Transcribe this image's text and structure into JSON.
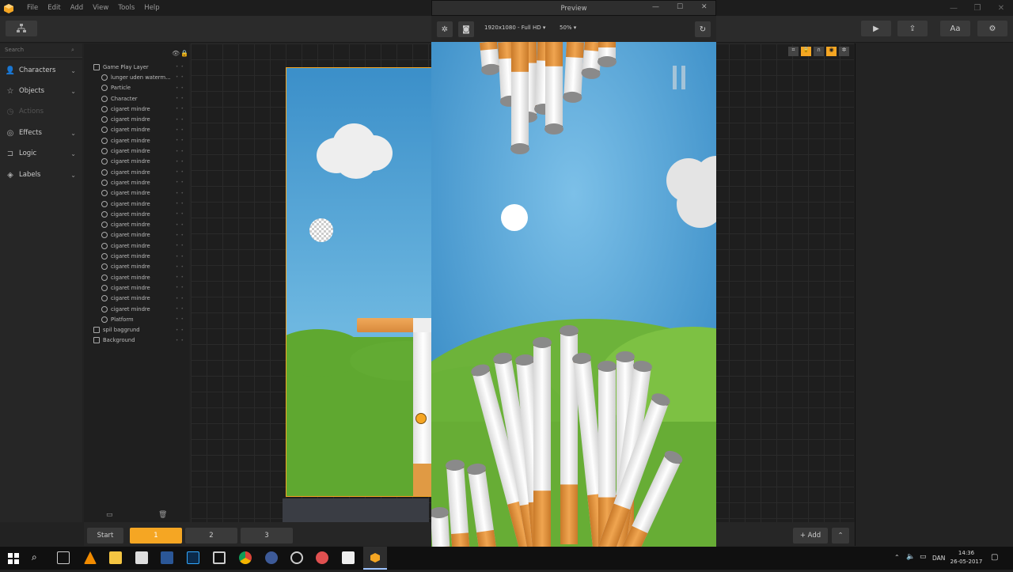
{
  "menu": [
    "File",
    "Edit",
    "Add",
    "View",
    "Tools",
    "Help"
  ],
  "search": {
    "placeholder": "Search"
  },
  "categories": [
    {
      "label": "Characters",
      "icon": "person-icon"
    },
    {
      "label": "Objects",
      "icon": "star-icon"
    },
    {
      "label": "Actions",
      "icon": "clock-icon",
      "disabled": true
    },
    {
      "label": "Effects",
      "icon": "swirl-icon"
    },
    {
      "label": "Logic",
      "icon": "logic-icon"
    },
    {
      "label": "Labels",
      "icon": "tag-icon"
    }
  ],
  "layers": {
    "group": "Game Play Layer",
    "items": [
      "lunger uden waterm...",
      "Particle",
      "Character",
      "cigaret mindre",
      "cigaret mindre",
      "cigaret mindre",
      "cigaret mindre",
      "cigaret mindre",
      "cigaret mindre",
      "cigaret mindre",
      "cigaret mindre",
      "cigaret mindre",
      "cigaret mindre",
      "cigaret mindre",
      "cigaret mindre",
      "cigaret mindre",
      "cigaret mindre",
      "cigaret mindre",
      "cigaret mindre",
      "cigaret mindre",
      "cigaret mindre",
      "cigaret mindre",
      "cigaret mindre",
      "Platform"
    ],
    "bottom": [
      "spil baggrund",
      "Background"
    ]
  },
  "scenes": {
    "start": "Start",
    "tabs": [
      "1",
      "2",
      "3"
    ],
    "add": "+ Add"
  },
  "toolbar": {
    "font_label": "Aa"
  },
  "preview": {
    "title": "Preview",
    "resolution": "1920x1080 - Full HD",
    "zoom": "50%"
  },
  "taskbar": {
    "lang": "DAN",
    "time": "14:36",
    "date": "26-05-2017"
  },
  "colors": {
    "accent": "#f5a623",
    "sky": "#4a9ad0",
    "grass": "#6fb83a"
  }
}
